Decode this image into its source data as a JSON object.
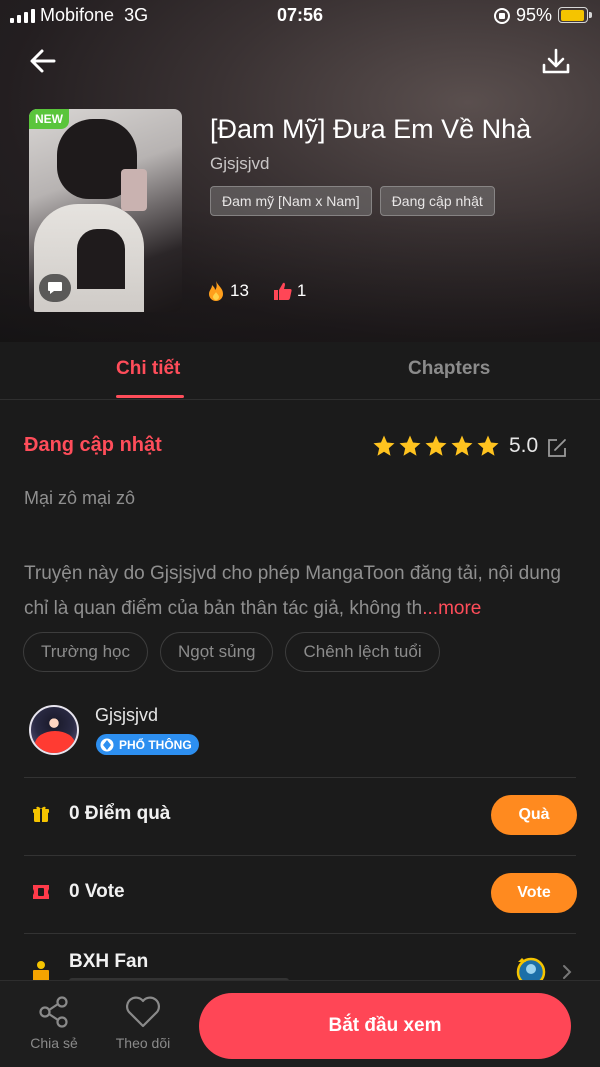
{
  "status_bar": {
    "carrier": "Mobifone",
    "network": "3G",
    "time": "07:56",
    "battery": "95%",
    "battery_level": 0.95
  },
  "header": {
    "back_icon": "arrow-left-icon",
    "download_icon": "download-icon"
  },
  "comic": {
    "new_badge": "NEW",
    "title": "[Đam Mỹ] Đưa Em Về Nhà",
    "author": "Gjsjsjvd",
    "genres": [
      "Đam mỹ [Nam x Nam]",
      "Đang cập nhật"
    ],
    "views": "13",
    "likes": "1"
  },
  "tabs": [
    {
      "label": "Chi tiết",
      "active": true
    },
    {
      "label": "Chapters",
      "active": false
    }
  ],
  "details": {
    "status": "Đang cập nhật",
    "rating": "5.0",
    "star_count": 5,
    "subtitle": "Mại zô mại zô",
    "description": "Truyện này do Gjsjsjvd cho phép MangaToon đăng tải, nội dung chỉ là quan điểm của bản thân tác giả, không th",
    "more_label": "...more",
    "tags": [
      "Trường học",
      "Ngọt sủng",
      "Chênh lệch tuổi"
    ]
  },
  "author_info": {
    "name": "Gjsjsjvd",
    "level": "PHỔ THÔNG"
  },
  "actions": {
    "gift": {
      "label": "0 Điểm quà",
      "button": "Quà"
    },
    "vote": {
      "label": "0 Vote",
      "button": "Vote"
    },
    "fan_rank": {
      "label": "BXH Fan"
    }
  },
  "bottom_bar": {
    "share": "Chia sẻ",
    "follow": "Theo dõi",
    "start": "Bắt đầu xem"
  },
  "colors": {
    "accent": "#ff4d5a",
    "orange": "#ff8a1f",
    "background": "#1b1b1b",
    "new_badge": "#5ac53b",
    "level_badge": "#2d8ff0"
  }
}
